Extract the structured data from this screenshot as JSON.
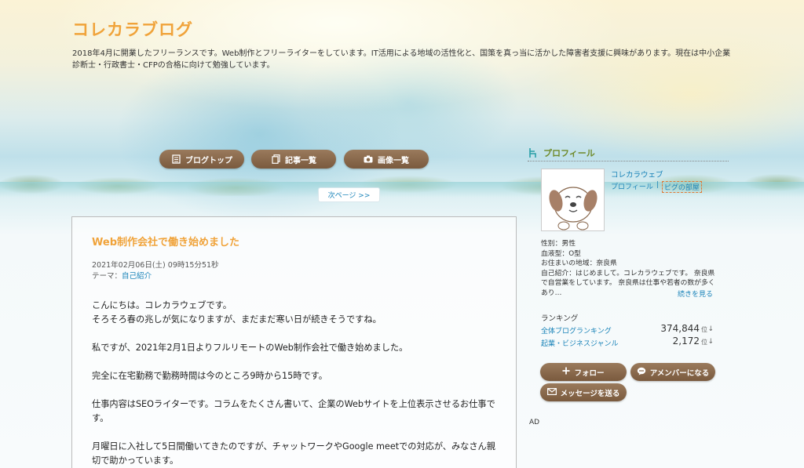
{
  "header": {
    "title": "コレカラブログ",
    "description": "2018年4月に開業したフリーランスです。Web制作とフリーライターをしています。IT活用による地域の活性化と、国策を真っ当に活かした障害者支援に興味があります。現在は中小企業診断士・行政書士・CFPの合格に向けて勉強しています。"
  },
  "nav": {
    "blog_top": "ブログトップ",
    "article_list": "記事一覧",
    "image_list": "画像一覧",
    "next_page": "次ページ >>"
  },
  "article": {
    "title": "Web制作会社で働き始めました",
    "date": "2021年02月06日(土) 09時15分51秒",
    "theme_label": "テーマ：",
    "theme_value": "自己紹介",
    "body": [
      "こんにちは。コレカラウェブです。",
      "そろそろ春の兆しが気になりますが、まだまだ寒い日が続きそうですね。",
      "私ですが、2021年2月1日よりフルリモートのWeb制作会社で働き始めました。",
      "完全に在宅勤務で勤務時間は今のところ9時から15時です。",
      "仕事内容はSEOライターです。コラムをたくさん書いて、企業のWebサイトを上位表示させるお仕事です。",
      "月曜日に入社して5日間働いてきたのですが、チャットワークやGoogle meetでの対応が、みなさん親切で助かっています。"
    ]
  },
  "sidebar": {
    "heading": "プロフィール",
    "name": "コレカラウェブ",
    "profile_link": "プロフィール",
    "piggy_link": "ピグの部屋",
    "gender": "性別：男性",
    "blood": "血液型：O型",
    "residence": "お住まいの地域：奈良県",
    "intro": "自己紹介：はじめまして。コレカラウェブです。 奈良県で自営業をしています。 奈良県は仕事や若者の数が多くあり…",
    "more": "続きを見る",
    "ranking_title": "ランキング",
    "rankings": [
      {
        "label": "全体ブログランキング",
        "value": "374,844",
        "unit": "位",
        "arrow": "↓"
      },
      {
        "label": "起業・ビジネスジャンル",
        "value": "2,172",
        "unit": "位",
        "arrow": "↓"
      }
    ],
    "follow": "フォロー",
    "member": "アメンバーになる",
    "message": "メッセージを送る"
  },
  "ad": "AD"
}
